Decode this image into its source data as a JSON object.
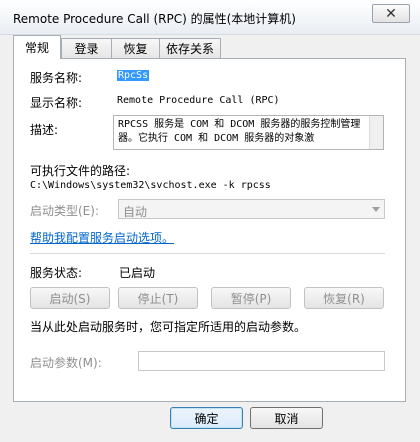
{
  "window": {
    "title": "Remote Procedure Call (RPC) 的属性(本地计算机)",
    "close_glyph": "✕"
  },
  "tabs": [
    {
      "label": "常规",
      "active": true
    },
    {
      "label": "登录",
      "active": false
    },
    {
      "label": "恢复",
      "active": false
    },
    {
      "label": "依存关系",
      "active": false
    }
  ],
  "general": {
    "service_name_label": "服务名称:",
    "service_name_value": "RpcSs",
    "display_name_label": "显示名称:",
    "display_name_value": "Remote Procedure Call (RPC)",
    "description_label": "描述:",
    "description_value": "RPCSS 服务是 COM 和 DCOM 服务器的服务控制管理器。它执行 COM 和 DCOM 服务器的对象激",
    "exe_path_label": "可执行文件的路径:",
    "exe_path_value": "C:\\Windows\\system32\\svchost.exe -k rpcss",
    "startup_type_label": "启动类型(E):",
    "startup_type_value": "自动",
    "help_link": "帮助我配置服务启动选项。",
    "status_label": "服务状态:",
    "status_value": "已启动",
    "start_button": "启动(S)",
    "stop_button": "停止(T)",
    "pause_button": "暂停(P)",
    "resume_button": "恢复(R)",
    "hint_text": "当从此处启动服务时，您可指定所适用的启动参数。",
    "start_params_label": "启动参数(M):",
    "start_params_value": ""
  },
  "footer": {
    "ok_button": "确定",
    "cancel_button": "取消"
  },
  "colors": {
    "accent": "#3399ff",
    "link": "#0066cc",
    "disabled_text": "#8f8f8f"
  }
}
